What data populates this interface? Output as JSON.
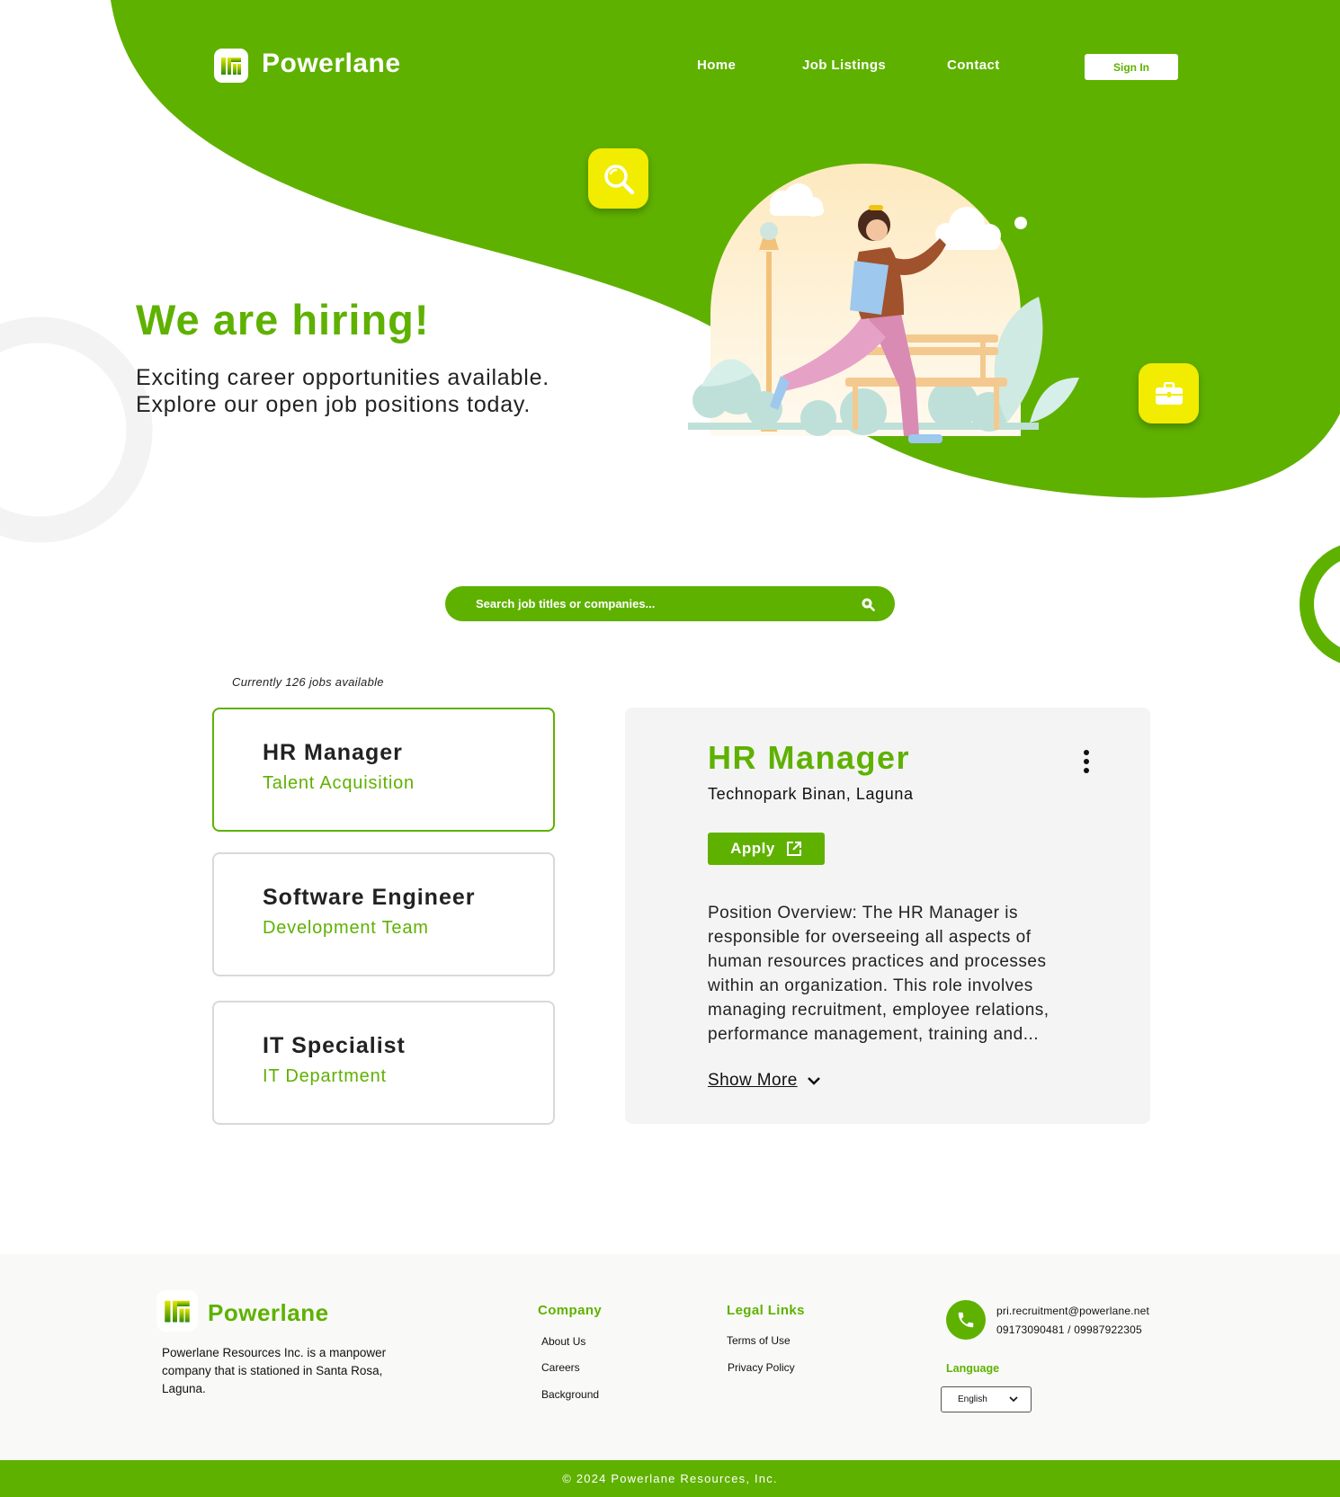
{
  "brand": {
    "name": "Powerlane",
    "accent": "#5fb100",
    "highlight": "#f1ec00",
    "logo_icon": "powerlane-logo-icon"
  },
  "nav": {
    "items": [
      {
        "label": "Home"
      },
      {
        "label": "Job Listings",
        "active": true
      },
      {
        "label": "Contact"
      }
    ],
    "signin_label": "Sign In"
  },
  "hero": {
    "title": "We are hiring!",
    "subtitle_line1": "Exciting career opportunities available.",
    "subtitle_line2": "Explore our open job positions today.",
    "search_tile_icon": "magnifier-icon",
    "briefcase_tile_icon": "briefcase-icon"
  },
  "search": {
    "placeholder": "Search job titles or companies...",
    "value": "",
    "icon": "search-icon"
  },
  "jobs": {
    "count_text": "Currently 126 jobs available",
    "items": [
      {
        "title": "HR Manager",
        "subtitle": "Talent Acquisition",
        "selected": true
      },
      {
        "title": "Software Engineer",
        "subtitle": "Development Team",
        "selected": false
      },
      {
        "title": "IT Specialist",
        "subtitle": "IT Department",
        "selected": false
      }
    ]
  },
  "detail": {
    "title": "HR Manager",
    "location": "Technopark Binan, Laguna",
    "apply_label": "Apply",
    "description": "Position Overview: The HR Manager is responsible for overseeing all aspects of human resources practices and processes within an organization. This role involves managing recruitment, employee relations, performance management, training and...",
    "show_more_label": "Show More"
  },
  "footer": {
    "brand": "Powerlane",
    "about": "Powerlane Resources Inc. is a manpower company that is stationed in Santa Rosa, Laguna.",
    "company_heading": "Company",
    "company_links": [
      "About Us",
      "Careers",
      "Background"
    ],
    "legal_heading": "Legal Links",
    "legal_links": [
      "Terms of Use",
      "Privacy Policy"
    ],
    "email": "pri.recruitment@powerlane.net",
    "phones": "09173090481 / 09987922305",
    "language_label": "Language",
    "language_value": "English",
    "copyright": "© 2024 Powerlane Resources, Inc."
  }
}
